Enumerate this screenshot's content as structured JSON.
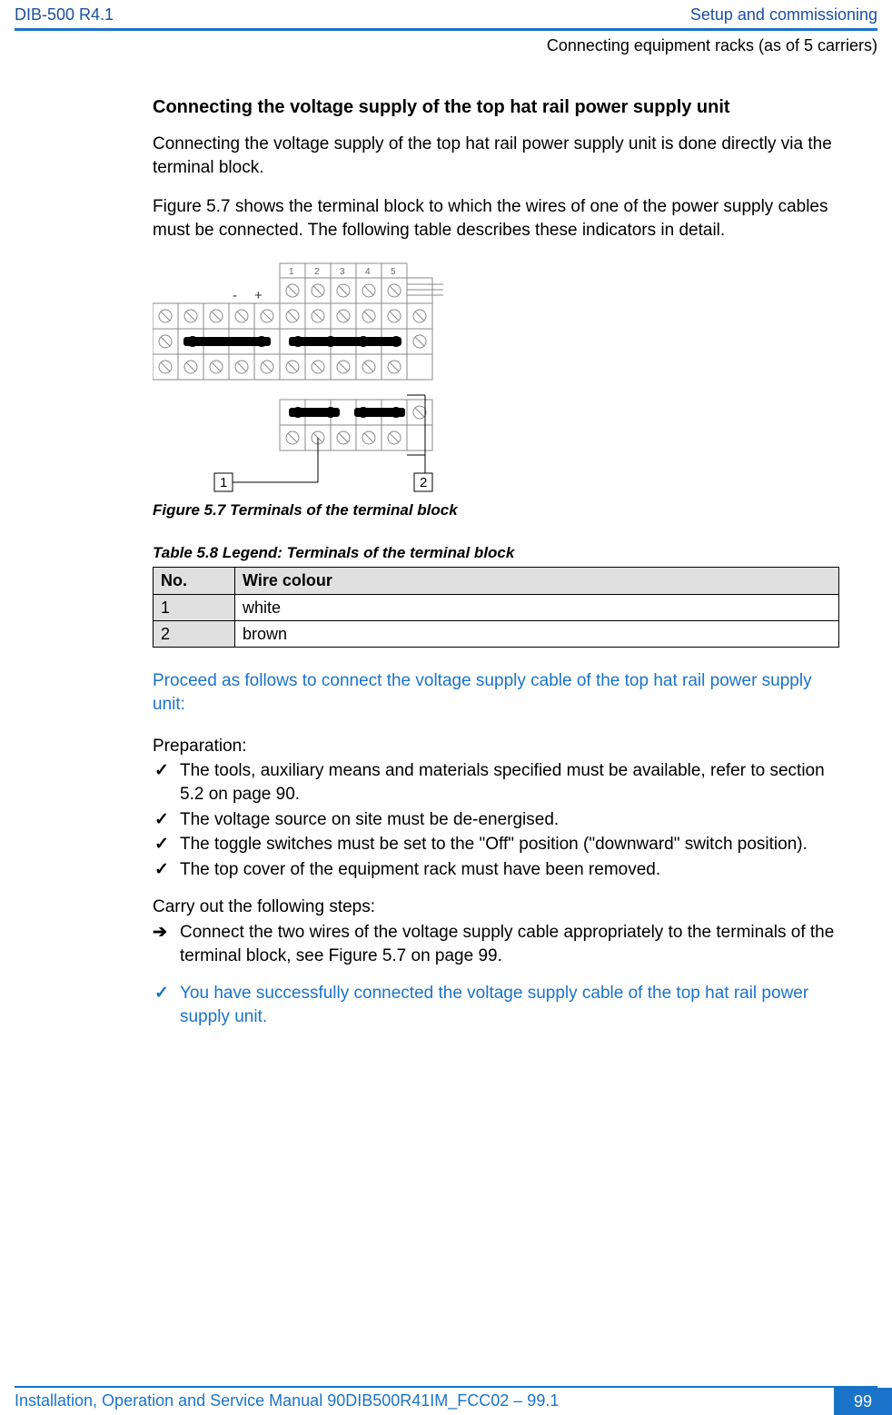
{
  "header": {
    "doc_id": "DIB-500 R4.1",
    "section": "Setup and commissioning",
    "subsection": "Connecting equipment racks (as of 5 carriers)"
  },
  "body": {
    "h3": "Connecting the voltage supply of the top hat rail power supply unit",
    "p1": "Connecting the voltage supply of the top hat rail power supply unit is done directly via the terminal block.",
    "p2": "Figure 5.7 shows the terminal block to which the wires of one of the power supply cables must be connected. The following table describes these indicators in detail.",
    "figure": {
      "callout1": "1",
      "callout2": "2",
      "caption": "Figure 5.7   Terminals of the terminal block"
    },
    "table": {
      "caption": "Table 5.8    Legend: Terminals of the terminal block",
      "head_no": "No.",
      "head_wire": "Wire colour",
      "rows": [
        {
          "no": "1",
          "wire": "white"
        },
        {
          "no": "2",
          "wire": "brown"
        }
      ]
    },
    "task_lead": "Proceed as follows to connect the voltage supply cable of the top hat rail power supply unit:",
    "prep_head": "Preparation:",
    "prep": [
      "The tools, auxiliary means and materials specified must be available, refer to section 5.2 on page 90.",
      "The voltage source on site must be de-energised.",
      "The toggle switches must be set to the \"Off\" position (\"downward\" switch position).",
      "The top cover of the equipment rack must have been removed."
    ],
    "steps_head": "Carry out the following steps:",
    "steps": [
      "Connect the two wires of the voltage supply cable appropriately to the terminals of the terminal block, see Figure 5.7 on page 99."
    ],
    "result": [
      "You have successfully connected the voltage supply cable of the top hat rail power supply unit."
    ]
  },
  "footer": {
    "text": "Installation, Operation and Service Manual 90DIB500R41IM_FCC02 – 99.1",
    "page": "99"
  }
}
